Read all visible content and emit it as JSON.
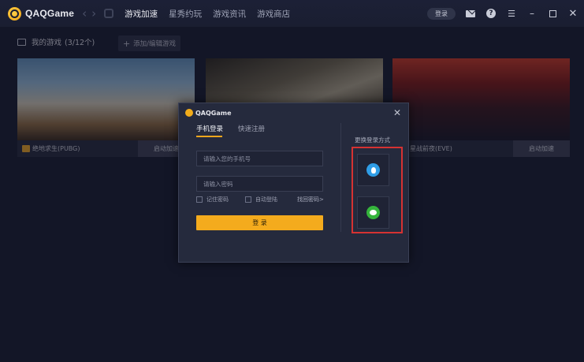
{
  "app": {
    "logo_text": "QAQGame",
    "nav_tabs": [
      "游戏加速",
      "星秀约玩",
      "游戏资讯",
      "游戏商店"
    ],
    "login_label": "登录"
  },
  "games": {
    "title": "我的游戏",
    "count": "(3/12个)",
    "add_label": "添加/编辑游戏",
    "cards": [
      {
        "name": "绝地求生(PUBG)",
        "launch": "启动加速"
      },
      {
        "name": "",
        "launch": ""
      },
      {
        "name": "星战前夜(EVE)",
        "launch": "启动加速"
      }
    ]
  },
  "dialog": {
    "title": "QAQGame",
    "tab_phone": "手机登录",
    "tab_register": "快速注册",
    "phone_placeholder": "请输入您的手机号",
    "password_placeholder": "请输入密码",
    "remember": "记住密码",
    "auto_login": "自动登陆",
    "forgot": "找回密码>",
    "login_button": "登 录",
    "alt_title": "更换登录方式"
  },
  "colors": {
    "accent": "#f4ab1d",
    "highlight": "#d63232",
    "qq": "#2f9de6",
    "wechat": "#35b43c"
  }
}
